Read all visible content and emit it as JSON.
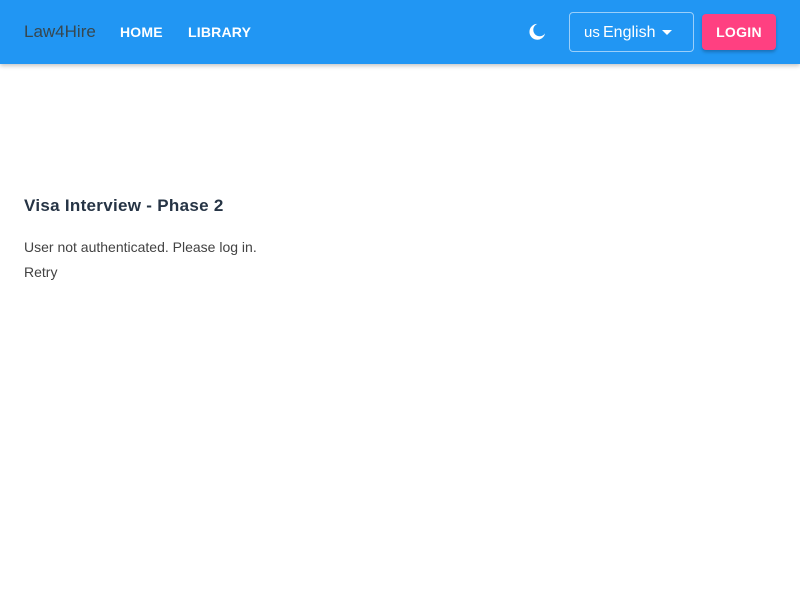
{
  "header": {
    "brand": "Law4Hire",
    "nav": {
      "home_label": "HOME",
      "library_label": "LIBRARY"
    },
    "theme_toggle_icon": "moon-icon",
    "language": {
      "flag_text": "us",
      "selected": "English",
      "caret_icon": "caret-down-icon"
    },
    "login_label": "LOGIN"
  },
  "main": {
    "title": "Visa Interview - Phase 2",
    "message": "User not authenticated. Please log in.",
    "retry_label": "Retry"
  },
  "colors": {
    "appbar": "#2196f3",
    "login_button": "#ff4081",
    "brand_text": "#37474f",
    "title_text": "#263445",
    "body_text": "#424242"
  }
}
